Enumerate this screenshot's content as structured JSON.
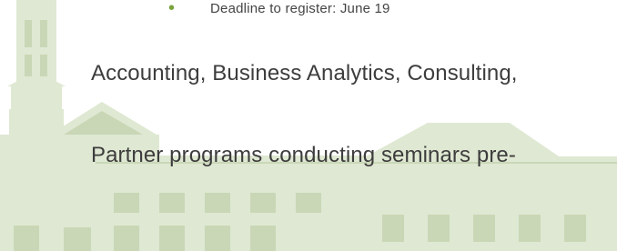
{
  "slide": {
    "bullet_text": "Deadline to register: June 19",
    "line_1": "Accounting, Business Analytics, Consulting,",
    "line_2": "Partner programs conducting seminars pre-"
  },
  "colors": {
    "watermark": "#dfe8d2",
    "watermark_dark": "#c9d7b6",
    "bullet": "#7aa33a",
    "text": "#3d3d3d"
  },
  "icons": {
    "bullet": "green-dot"
  }
}
